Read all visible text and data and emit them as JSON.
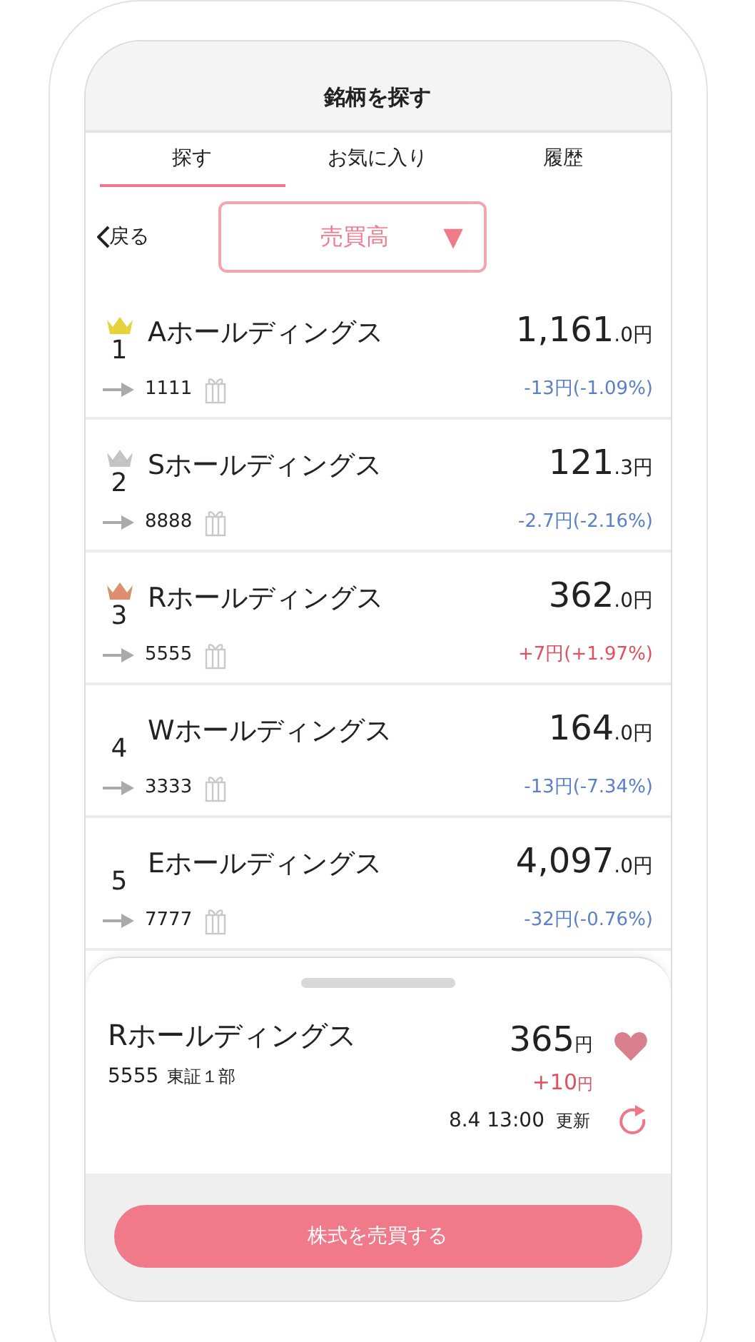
{
  "header": {
    "title": "銘柄を探す"
  },
  "tabs": [
    {
      "label": "探す",
      "selected": true
    },
    {
      "label": "お気に入り",
      "selected": false
    },
    {
      "label": "履歴",
      "selected": false
    }
  ],
  "back": {
    "label": "戻る"
  },
  "sort": {
    "value": "売買高",
    "arrow": "▼"
  },
  "rows": [
    {
      "rank": "1",
      "color": "#e6d23a",
      "name": "Aホールディングス",
      "code": "1111",
      "price": "1,161",
      "decimal": ".0",
      "unit": "円",
      "change": "-13円(-1.09%)",
      "rising": false
    },
    {
      "rank": "2",
      "color": "#c4c4c4",
      "name": "Sホールディングス",
      "code": "8888",
      "price": "121",
      "decimal": ".3",
      "unit": "円",
      "change": "-2.7円(-2.16%)",
      "rising": false
    },
    {
      "rank": "3",
      "color": "#dd8e6e",
      "name": "Rホールディングス",
      "code": "5555",
      "price": "362",
      "decimal": ".0",
      "unit": "円",
      "change": "+7円(+1.97%)",
      "rising": true
    },
    {
      "rank": "4",
      "name": "Wホールディングス",
      "code": "3333",
      "price": "164",
      "decimal": ".0",
      "unit": "円",
      "change": "-13円(-7.34%)",
      "rising": false
    },
    {
      "rank": "5",
      "name": "Eホールディングス",
      "code": "7777",
      "price": "4,097",
      "decimal": ".0",
      "unit": "円",
      "change": "-32円(-0.76%)",
      "rising": false
    }
  ],
  "detail": {
    "name": "Rホールディングス",
    "code": "5555",
    "market": "東証１部",
    "price": "365",
    "unit": "円",
    "change": "+10",
    "change_unit": "円",
    "rising": true,
    "time": "8.4 13:00",
    "update": "更新"
  },
  "action": {
    "label": "株式を売買する"
  }
}
